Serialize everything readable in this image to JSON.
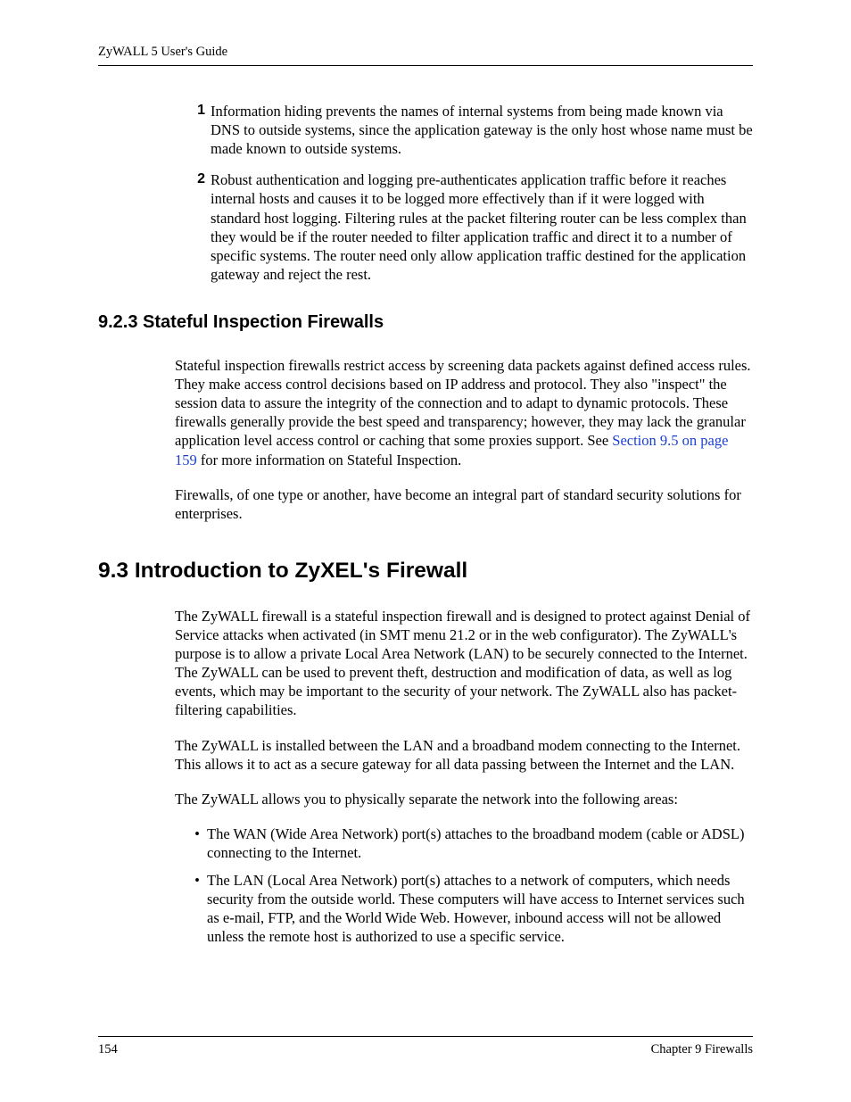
{
  "header": {
    "title": "ZyWALL 5 User's Guide"
  },
  "numbered": {
    "n1": "1",
    "t1": "Information hiding prevents the names of internal systems from being made known via DNS to outside systems, since the application gateway is the only host whose name must be made known to outside systems.",
    "n2": "2",
    "t2": "Robust authentication and logging pre-authenticates application traffic before it reaches internal hosts and causes it to be logged more effectively than if it were logged with standard host logging. Filtering rules at the packet filtering router can be less complex than they would be if the router needed to filter application traffic and direct it to a number of specific systems. The router need only allow application traffic destined for the application gateway and reject the rest."
  },
  "sec923": {
    "heading": "9.2.3  Stateful Inspection Firewalls",
    "p1a": "Stateful inspection firewalls restrict access by screening data packets against defined access rules. They make access control decisions based on IP address and protocol. They also \"inspect\" the session data to assure the integrity of the connection and to adapt to dynamic protocols. These firewalls generally provide the best speed and transparency; however, they may lack the granular application level access control or caching that some proxies support. See ",
    "p1link": "Section 9.5 on page 159",
    "p1b": " for more information on Stateful Inspection.",
    "p2": "Firewalls, of one type or another, have become an integral part of standard security solutions for enterprises."
  },
  "sec93": {
    "heading": "9.3  Introduction to ZyXEL's Firewall",
    "p1": "The ZyWALL firewall is a stateful inspection firewall and is designed to protect against Denial of Service attacks when activated (in SMT menu 21.2 or in the web configurator). The ZyWALL's purpose is to allow a private Local Area Network (LAN) to be securely connected to the Internet. The ZyWALL can be used to prevent theft, destruction and modification of data, as well as log events, which may be important to the security of your network. The ZyWALL also has packet-filtering capabilities.",
    "p2": "The ZyWALL is installed between the LAN and a broadband modem connecting to the Internet. This allows it to act as a secure gateway for all data passing between the Internet and the LAN.",
    "p3": "The ZyWALL allows you to physically separate the network into the following areas:",
    "b1": "The WAN (Wide Area Network) port(s) attaches to the broadband modem (cable or ADSL) connecting to the Internet.",
    "b2": "The LAN (Local Area Network) port(s) attaches to a network of computers, which needs security from the outside world. These computers will have access to Internet services such as e-mail, FTP, and the World Wide Web. However, inbound access will not be allowed unless the remote host is authorized to use a specific service."
  },
  "footer": {
    "pagenum": "154",
    "chapter": "Chapter 9 Firewalls"
  }
}
